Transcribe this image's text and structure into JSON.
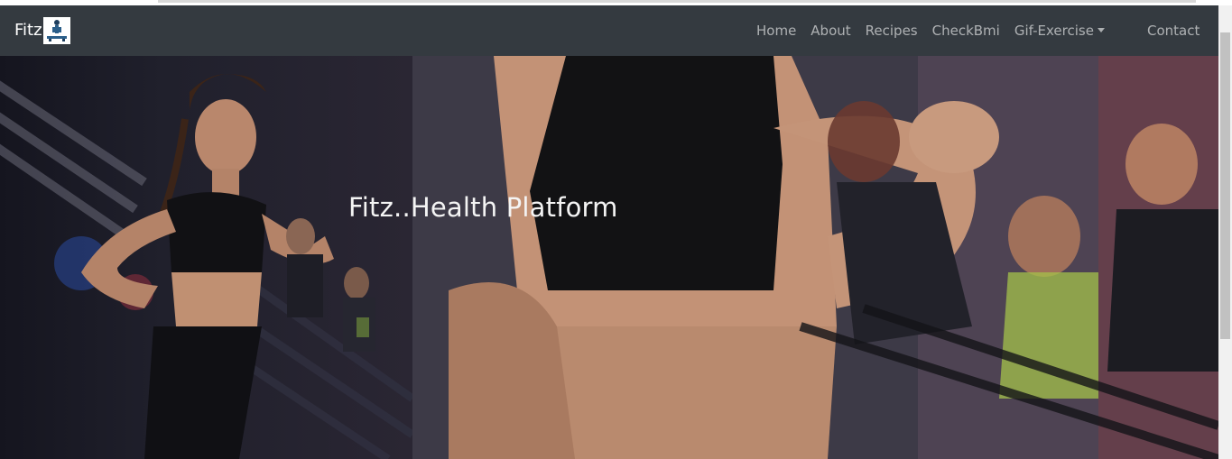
{
  "brand": {
    "name": "Fitz"
  },
  "nav": {
    "items": [
      {
        "label": "Home"
      },
      {
        "label": "About"
      },
      {
        "label": "Recipes"
      },
      {
        "label": "CheckBmi"
      },
      {
        "label": "Gif-Exercise"
      }
    ],
    "contact": "Contact"
  },
  "hero": {
    "title": "Fitz..Health Platform"
  },
  "colors": {
    "navbar": "#343a40",
    "nav_text": "#ffffff99",
    "hero_text": "#f4f4f4"
  }
}
